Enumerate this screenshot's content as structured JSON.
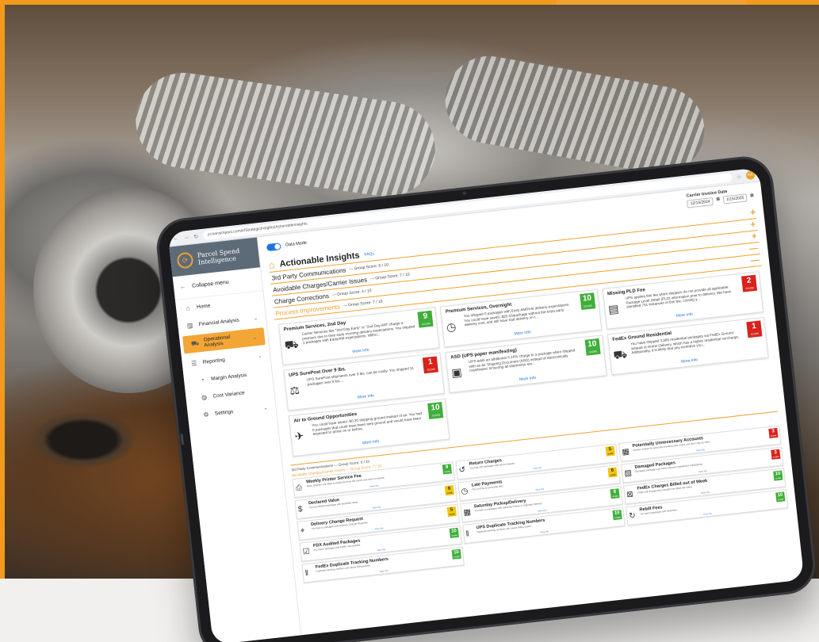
{
  "browser": {
    "url": "pi.transimpact.com/#/StrategicInsights/ActionableInsights"
  },
  "user": {
    "initials": "KA"
  },
  "logo": {
    "line1": "Parcel Spend",
    "line2": "Intelligence"
  },
  "sidebar": {
    "collapse_label": "Collapse menu",
    "items": [
      {
        "label": "Home",
        "icon": "home-icon"
      },
      {
        "label": "Financial Analysis",
        "icon": "chart-icon"
      },
      {
        "label": "Operational Analysis",
        "icon": "truck-icon",
        "active": true
      },
      {
        "label": "Reporting",
        "icon": "sliders-icon"
      },
      {
        "label": "Margin Analysis",
        "icon": "margin-icon"
      },
      {
        "label": "Cost Variance",
        "icon": "variance-icon"
      },
      {
        "label": "Settings",
        "icon": "gear-icon"
      }
    ]
  },
  "topbar": {
    "data_mode_label": "Data Mode",
    "invoice_label": "Carrier Invoice Date",
    "date_from": "12/15/2024",
    "date_to": "1/15/2025"
  },
  "page": {
    "title": "Actionable Insights",
    "faq": "FAQs"
  },
  "groups": [
    {
      "title": "3rd Party Communications",
      "score": "— Group Score: 6 / 10",
      "state": "+"
    },
    {
      "title": "Avoidable Charges/Carrier Issues",
      "score": "— Group Score: 7 / 10",
      "state": "+"
    },
    {
      "title": "Charge Corrections",
      "score": "— Group Score: 4 / 10",
      "state": "—"
    },
    {
      "title": "Process Improvements",
      "score": "— Group Score: 7 / 10",
      "state": "—"
    }
  ],
  "cards": [
    {
      "title": "Premium Services, 2nd Day",
      "body": "Carrier Services like \"2nd Day Early\" or \"2nd Day AM\" charge a premium due to their early morning delivery expectations. You shipped 1 packages with Early/AM expectations. Witho...",
      "score": "9",
      "color": "green",
      "more": "More Info",
      "icon": "truck-clock-icon"
    },
    {
      "title": "Premium Services, Overnight",
      "body": "You shipped 0 packages with Early AM/First delivery expectations. You could have saved -$25.53/package without the extra early delivery cost, and still have had delivery on t...",
      "score": "10",
      "color": "green",
      "more": "More Info",
      "icon": "clock-icon"
    },
    {
      "title": "Missing PLD Fee",
      "body": "UPS applies this fee when shippers do not provide all applicable Package Level Detail (PLD) information prior to delivery. We have identified 751 instances of this fee, costing y...",
      "score": "2",
      "color": "red",
      "more": "More Info",
      "icon": "document-icon"
    },
    {
      "title": "UPS SurePost Over 9 lbs.",
      "body": "UPS SurePost shipments over 9 lbs. can be costly. You shipped 11 packages over 9 lbs....",
      "score": "1",
      "color": "red",
      "more": "More Info",
      "icon": "scale-icon"
    },
    {
      "title": "ASD (UPS paper manifesting)",
      "body": "UPS adds an additional 5-10% charge to a package when shipped with an Air Shipping Document (ASD) instead of electronically manifested. Ensuring all shipments are...",
      "score": "10",
      "color": "green",
      "more": "More Info",
      "icon": "boxes-icon"
    },
    {
      "title": "FedEx Ground Residential",
      "body": "You have shipped 3,960 residential packages via FedEx Ground instead of Home Delivery, which has a higher residential surcharge. Additionally, it is likely that any incentive you...",
      "score": "1",
      "color": "red",
      "more": "More Info",
      "icon": "truck-icon"
    },
    {
      "title": "Air to Ground Opportunities",
      "body": "You could have saved -$0.20 shipping ground instead of air. You had 0 packages that could have been sent ground and would have been expected to arrive on or before.",
      "score": "10",
      "color": "green",
      "more": "More Info",
      "icon": "plane-truck-icon"
    }
  ],
  "summary": {
    "row1": "3rd Party Communications — Group Score: 6 / 10",
    "row2": "Avoidable Charges/Carrier Issues — Group Score: 7 / 10",
    "items": [
      {
        "title": "Weekly Printer Service Fee",
        "body": "Many shippers are billed a weekly fee from the carrier and were not aware.",
        "score": "9",
        "color": "green",
        "icon": "printer-icon"
      },
      {
        "title": "Return Charges",
        "body": "You had 225 packages with return charges.",
        "score": "5",
        "color": "yellow",
        "icon": "return-icon"
      },
      {
        "title": "Potentially Unnecessary Accounts",
        "body": "Carriers charge for accounts including ones where you don't ship as often.",
        "score": "3",
        "color": "red",
        "icon": "accounts-icon"
      },
      {
        "title": "Declared Value",
        "body": "You had 98,830 packages with Declared Value.",
        "score": "6",
        "color": "yellow",
        "icon": "value-icon"
      },
      {
        "title": "Late Payments",
        "body": "Pay on time to avoid late fees.",
        "score": "6",
        "color": "yellow",
        "icon": "late-icon"
      },
      {
        "title": "Damaged Packages",
        "body": "Damaged packages can have customer satisfaction implications.",
        "score": "3",
        "color": "red",
        "icon": "damaged-icon"
      },
      {
        "title": "Delivery Change Request",
        "body": "You had 31 packages with Delivery Change Requests.",
        "score": "5",
        "color": "yellow",
        "icon": "pin-icon"
      },
      {
        "title": "Saturday Pickup/Delivery",
        "body": "You had 21 packages with Saturday Pickup or Saturday Delivery.",
        "score": "8",
        "color": "green",
        "icon": "calendar-icon"
      },
      {
        "title": "FedEx Charges Billed out of Week",
        "body": "FedEx bill charges that shouldn't be billed this week.",
        "score": "10",
        "color": "green",
        "icon": "calendar-x-icon"
      },
      {
        "title": "FDX Audited Packages",
        "body": "You had 0 packages that FedEx has audited.",
        "score": "10",
        "color": "green",
        "icon": "box-check-icon"
      },
      {
        "title": "UPS Duplicate Tracking Numbers",
        "body": "Duplicate tracking numbers can cause billing issues.",
        "score": "10",
        "color": "green",
        "icon": "barcode-icon"
      },
      {
        "title": "Rebill Fees",
        "body": "You had 0 packages with rebill fees.",
        "score": "10",
        "color": "green",
        "icon": "rebill-icon"
      },
      {
        "title": "FedEx Duplicate Tracking Numbers",
        "body": "Duplicate tracking numbers can cause billing issues.",
        "score": "10",
        "color": "green",
        "icon": "barcode-icon"
      }
    ]
  },
  "labels": {
    "score": "SCORE",
    "more": "More Info"
  },
  "colors": {
    "accent": "#f0a030",
    "green": "#3fae3a",
    "red": "#d9221b",
    "yellow": "#f1c40f",
    "link": "#1f73e0"
  }
}
